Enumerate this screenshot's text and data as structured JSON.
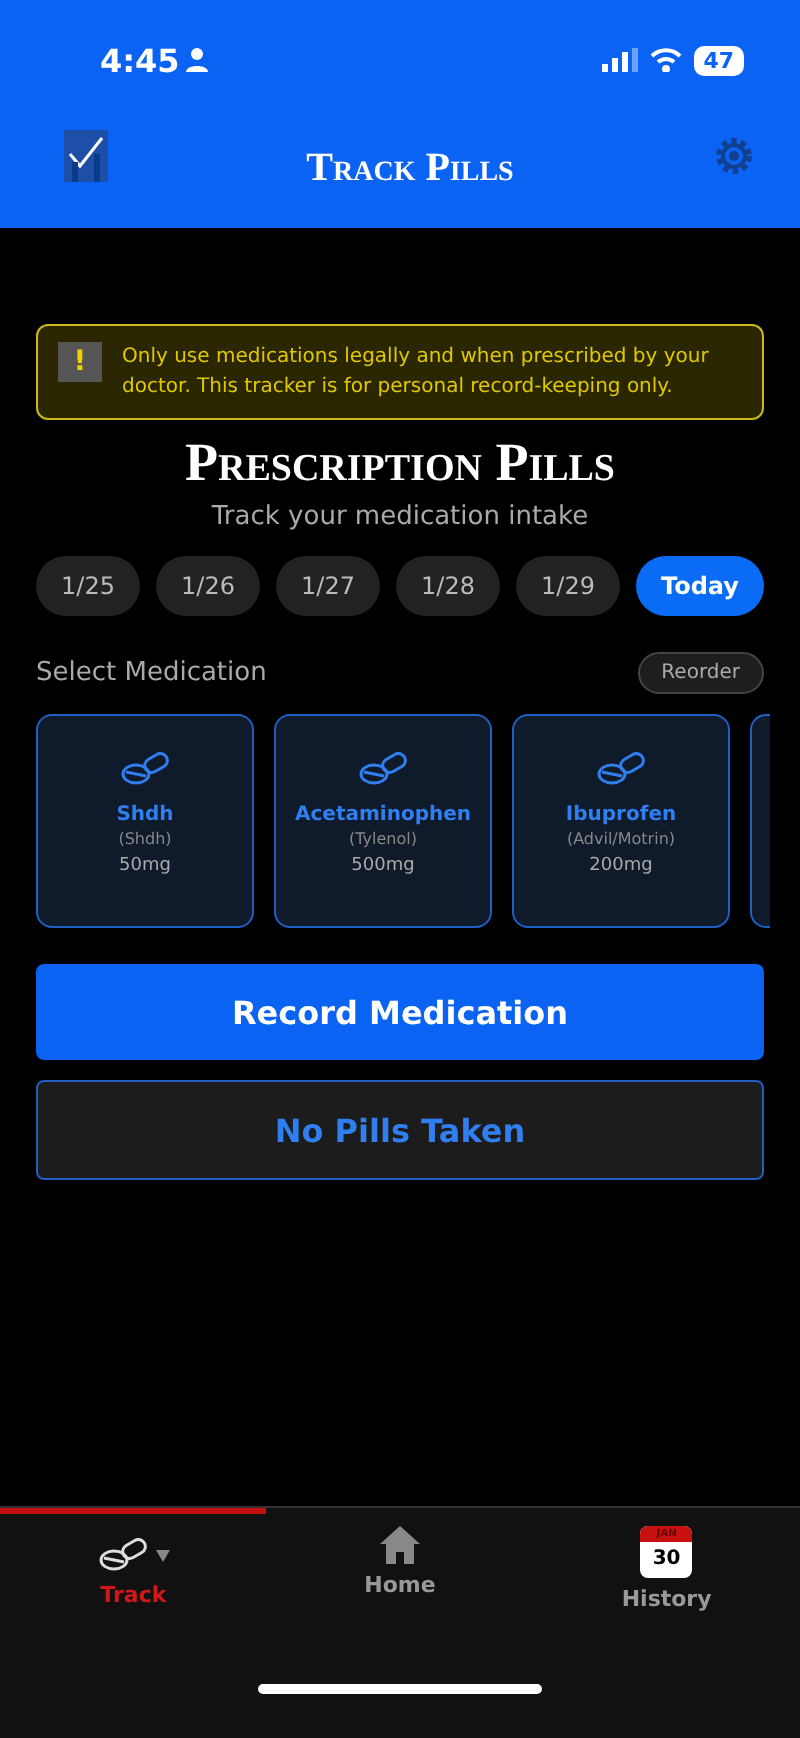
{
  "status_bar": {
    "time": "4:45",
    "battery": "47"
  },
  "header": {
    "title": "Track Pills"
  },
  "warning": {
    "icon": "!",
    "text": "Only use medications legally and when prescribed by your doctor. This tracker is for personal record-keeping only."
  },
  "title": "Prescription Pills",
  "subtitle": "Track your medication intake",
  "dates": [
    {
      "label": "1/25",
      "selected": false
    },
    {
      "label": "1/26",
      "selected": false
    },
    {
      "label": "1/27",
      "selected": false
    },
    {
      "label": "1/28",
      "selected": false
    },
    {
      "label": "1/29",
      "selected": false
    },
    {
      "label": "Today",
      "selected": true
    }
  ],
  "section": {
    "label": "Select Medication",
    "button": "Reorder"
  },
  "medications": [
    {
      "name": "Shdh",
      "brand": "(Shdh)",
      "dose": "50mg",
      "selected": false
    },
    {
      "name": "Acetaminophen",
      "brand": "(Tylenol)",
      "dose": "500mg",
      "selected": false
    },
    {
      "name": "Ibuprofen",
      "brand": "(Advil/Motrin)",
      "dose": "200mg",
      "selected": false
    }
  ],
  "more_medications_peek": true,
  "actions": [
    {
      "label": "Record Medication",
      "kind": "primary"
    },
    {
      "label": "No Pills Taken",
      "kind": "outline"
    }
  ],
  "tab_bar": [
    {
      "label": "Track",
      "kind": "pill",
      "selected": true
    },
    {
      "label": "Home",
      "kind": "home",
      "selected": false
    },
    {
      "label": "History",
      "kind": "calendar",
      "selected": false,
      "month": "JAN",
      "day": "30"
    }
  ]
}
